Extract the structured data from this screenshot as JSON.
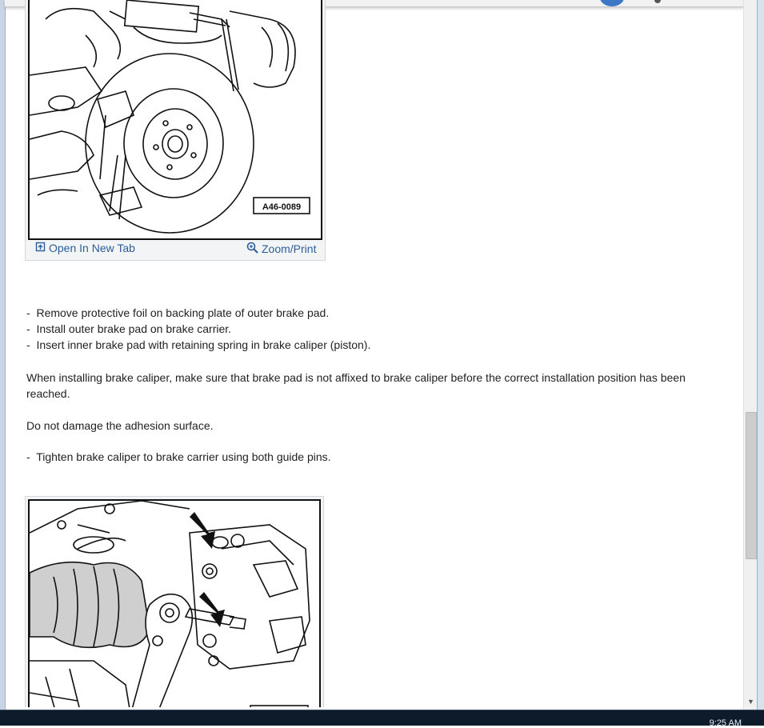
{
  "figure1": {
    "code": "A46-0089",
    "open_tab_label": "Open In New Tab",
    "zoom_label": "Zoom/Print"
  },
  "steps1": [
    "Remove protective foil on backing plate of outer brake pad.",
    "Install outer brake pad on brake carrier.",
    "Insert inner brake pad with retaining spring in brake caliper (piston)."
  ],
  "note1": "When installing brake caliper, make sure that brake pad is not affixed to brake caliper before the correct installation position has been reached.",
  "note2": "Do not damage the adhesion surface.",
  "step2": "Tighten brake caliper to brake carrier using both guide pins.",
  "bullet": "-",
  "taskbar": {
    "clock": "9:25 AM"
  },
  "icons": {
    "open_tab": "open-in-new-tab-icon",
    "zoom": "magnifier-zoom-icon",
    "scroll_down": "scroll-down-arrow-icon"
  }
}
